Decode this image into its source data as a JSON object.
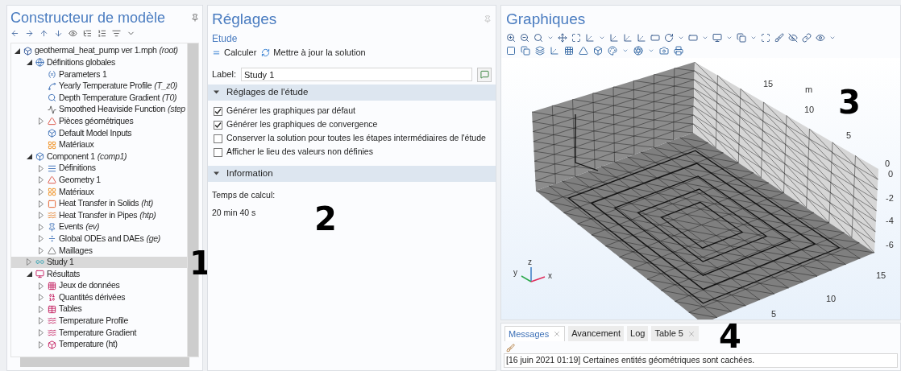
{
  "model_builder": {
    "title": "Constructeur de modèle",
    "annotation": "1",
    "tree": [
      {
        "label": "geothermal_heat_pump ver 1.mph",
        "suffix": "(root)",
        "expanded": true,
        "selected": false,
        "children": [
          {
            "label": "Définitions globales",
            "expanded": true,
            "selected": false,
            "children": [
              {
                "label": "Parameters 1",
                "selected": false
              },
              {
                "label": "Yearly Temperature Profile",
                "suffix": "(T_z0)",
                "selected": false
              },
              {
                "label": "Depth Temperature Gradient",
                "suffix": "(T0)",
                "selected": false
              },
              {
                "label": "Smoothed Heaviside Function",
                "suffix": "(step",
                "selected": false
              },
              {
                "label": "Pièces géométriques",
                "expanded": false,
                "selected": false
              },
              {
                "label": "Default Model Inputs",
                "selected": false
              },
              {
                "label": "Matériaux",
                "selected": false
              }
            ]
          },
          {
            "label": "Component 1",
            "suffix": "(comp1)",
            "expanded": true,
            "selected": false,
            "children": [
              {
                "label": "Définitions",
                "expanded": false,
                "selected": false
              },
              {
                "label": "Geometry 1",
                "expanded": false,
                "selected": false
              },
              {
                "label": "Matériaux",
                "expanded": false,
                "selected": false
              },
              {
                "label": "Heat Transfer in Solids",
                "suffix": "(ht)",
                "expanded": false,
                "selected": false
              },
              {
                "label": "Heat Transfer in Pipes",
                "suffix": "(htp)",
                "expanded": false,
                "selected": false
              },
              {
                "label": "Events",
                "suffix": "(ev)",
                "expanded": false,
                "selected": false
              },
              {
                "label": "Global ODEs and DAEs",
                "suffix": "(ge)",
                "expanded": false,
                "selected": false
              },
              {
                "label": "Maillages",
                "expanded": false,
                "selected": false
              }
            ]
          },
          {
            "label": "Study 1",
            "expanded": false,
            "selected": true
          },
          {
            "label": "Résultats",
            "expanded": true,
            "selected": false,
            "children": [
              {
                "label": "Jeux de données",
                "expanded": false,
                "selected": false
              },
              {
                "label": "Quantités dérivées",
                "expanded": false,
                "selected": false
              },
              {
                "label": "Tables",
                "expanded": false,
                "selected": false
              },
              {
                "label": "Temperature Profile",
                "expanded": false,
                "selected": false
              },
              {
                "label": "Temperature Gradient",
                "expanded": false,
                "selected": false
              },
              {
                "label": "Temperature (ht)",
                "expanded": false,
                "selected": false
              }
            ]
          }
        ]
      }
    ]
  },
  "settings": {
    "title": "Réglages",
    "subtitle": "Etude",
    "annotation": "2",
    "actions": [
      {
        "label": "Calculer"
      },
      {
        "label": "Mettre à jour la solution"
      }
    ],
    "label_field": {
      "label": "Label:",
      "value": "Study 1"
    },
    "sections": [
      {
        "kind": "checkboxes",
        "title": "Réglages de l'étude",
        "expanded": true,
        "items": [
          {
            "label": "Générer les graphiques par défaut",
            "checked": true
          },
          {
            "label": "Générer les graphiques de convergence",
            "checked": true
          },
          {
            "label": "Conserver la solution pour toutes les étapes intermédiaires de l'étude",
            "checked": false
          },
          {
            "label": "Afficher le lieu des valeurs non définies",
            "checked": false
          }
        ]
      },
      {
        "kind": "info",
        "title": "Information",
        "expanded": true,
        "lines": [
          "Temps de calcul:",
          "20 min 40 s"
        ]
      }
    ]
  },
  "graphics": {
    "title": "Graphiques",
    "annotation": "3",
    "axis_labels": [
      "15",
      "m",
      "10",
      "5",
      "0",
      "0",
      "-2",
      "-4",
      "-6",
      "15",
      "10",
      "5"
    ],
    "triad": [
      "z",
      "y",
      "x"
    ]
  },
  "messages": {
    "annotation": "4",
    "tabs": [
      {
        "label": "Messages",
        "selected": true,
        "closable": true
      },
      {
        "label": "Avancement",
        "selected": false,
        "closable": false
      },
      {
        "label": "Log",
        "selected": false,
        "closable": false
      },
      {
        "label": "Table 5",
        "selected": false,
        "closable": true
      }
    ],
    "lines": [
      "[16 juin 2021 01:19] Certaines entités géométriques sont cachées."
    ]
  }
}
